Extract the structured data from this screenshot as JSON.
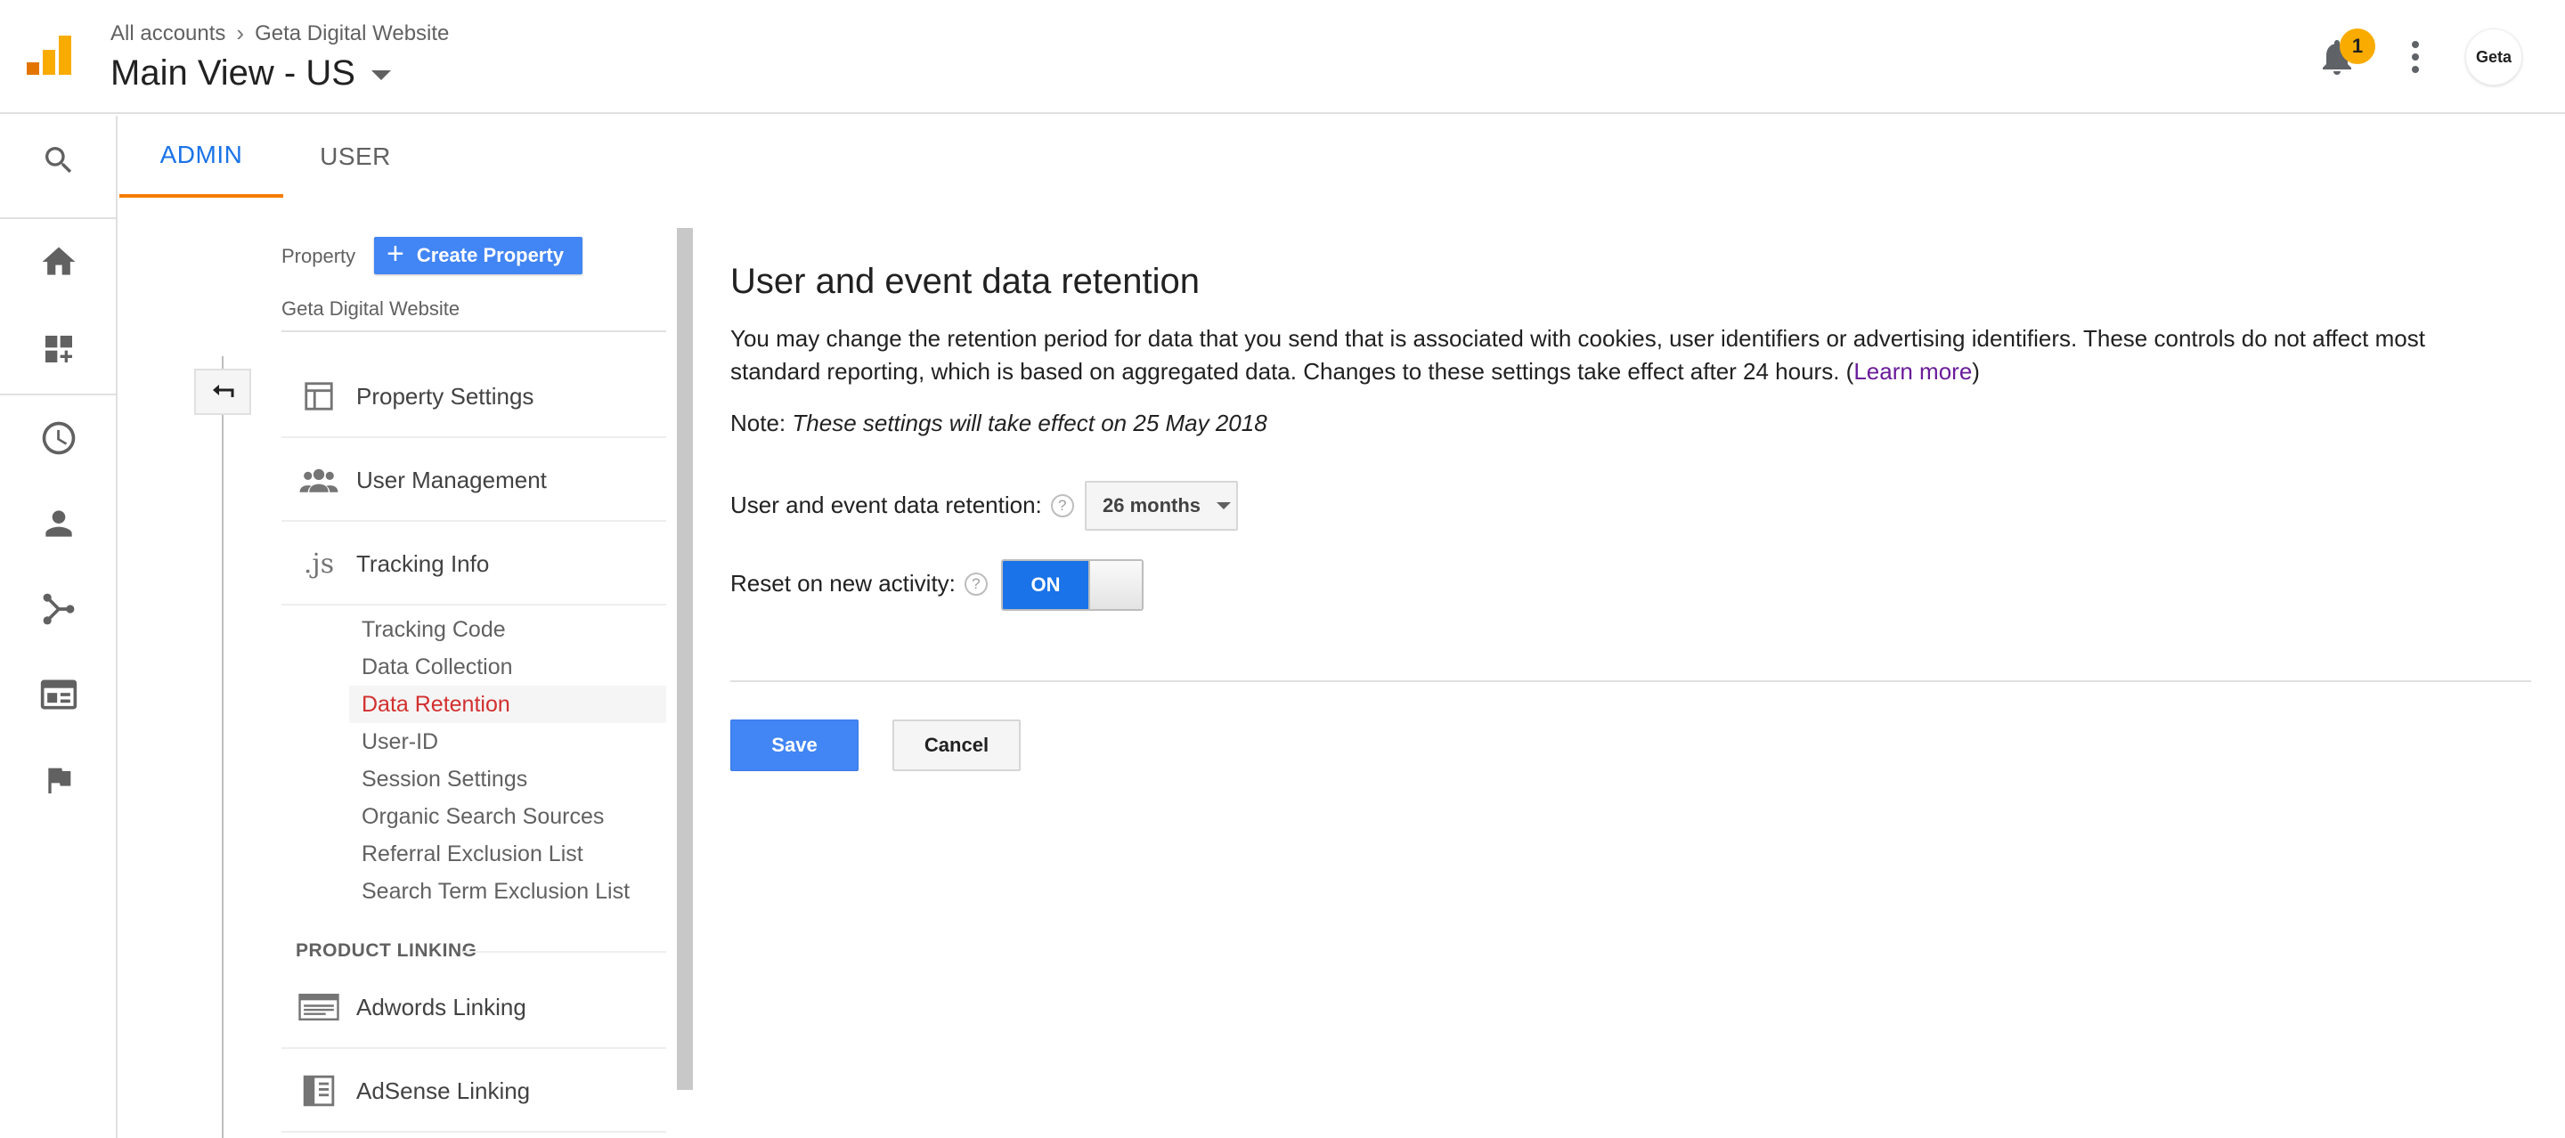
{
  "header": {
    "breadcrumb": {
      "root": "All accounts",
      "separator": "›",
      "property": "Geta Digital Website"
    },
    "view_title": "Main View - US",
    "notifications_count": "1",
    "avatar_text": "Geta"
  },
  "rail": {
    "icons": [
      "search-icon",
      "home-icon",
      "customization-icon",
      "realtime-clock-icon",
      "audience-person-icon",
      "acquisition-icon",
      "behavior-icon",
      "conversions-flag-icon"
    ]
  },
  "tabs": {
    "admin": "ADMIN",
    "user": "USER"
  },
  "property_column": {
    "label": "Property",
    "create_button": "Create Property",
    "property_name": "Geta Digital Website",
    "nav": [
      {
        "label": "Property Settings",
        "icon": "property-settings-icon"
      },
      {
        "label": "User Management",
        "icon": "user-management-icon"
      },
      {
        "label": "Tracking Info",
        "icon": "js-icon",
        "icon_text": ".js"
      }
    ],
    "tracking_sub": [
      "Tracking Code",
      "Data Collection",
      "Data Retention",
      "User-ID",
      "Session Settings",
      "Organic Search Sources",
      "Referral Exclusion List",
      "Search Term Exclusion List"
    ],
    "active_sub": "Data Retention",
    "product_linking_header": "PRODUCT LINKING",
    "linking": [
      {
        "label": "Adwords Linking",
        "icon": "adwords-icon"
      },
      {
        "label": "AdSense Linking",
        "icon": "adsense-icon"
      }
    ]
  },
  "main": {
    "title": "User and event data retention",
    "description_part1": "You may change the retention period for data that you send that is associated with cookies, user identifiers or advertising identifiers. These controls do not affect most standard reporting, which is based on aggregated data. Changes to these settings take effect after 24 hours. (",
    "learn_more": "Learn more",
    "description_part2": ")",
    "note_label": "Note:",
    "note_text": "These settings will take effect on 25 May 2018",
    "retention_label": "User and event data retention:",
    "retention_value": "26 months",
    "reset_label": "Reset on new activity:",
    "toggle_on": "ON",
    "help_glyph": "?",
    "save": "Save",
    "cancel": "Cancel"
  },
  "colors": {
    "accent": "#1a73e8",
    "tab_underline": "#f57c00",
    "active_link": "#d32f2f",
    "button_blue": "#4285f4"
  }
}
